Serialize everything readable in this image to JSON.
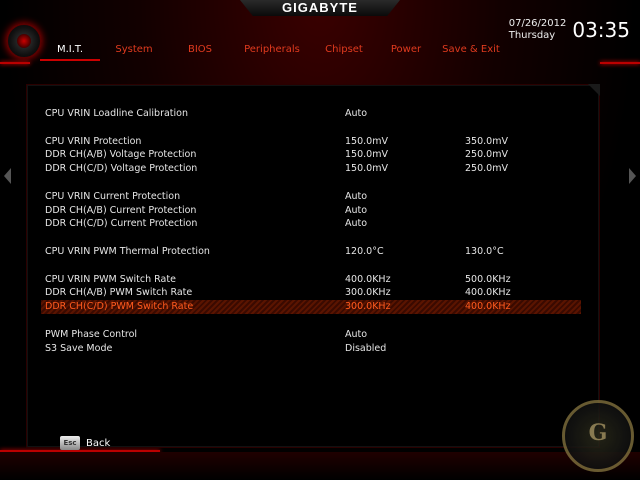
{
  "header": {
    "brand": "GIGABYTE",
    "date": "07/26/2012",
    "weekday": "Thursday",
    "time": "03:35"
  },
  "nav": {
    "tabs": [
      {
        "label": "M.I.T.",
        "active": true
      },
      {
        "label": "System",
        "active": false
      },
      {
        "label": "BIOS",
        "active": false
      },
      {
        "label": "Peripherals",
        "active": false
      },
      {
        "label": "Chipset",
        "active": false
      },
      {
        "label": "Power",
        "active": false
      },
      {
        "label": "Save & Exit",
        "active": false
      }
    ]
  },
  "settings": {
    "rows": [
      {
        "label": "CPU VRIN Loadline Calibration",
        "v1": "Auto",
        "v2": ""
      },
      {
        "gap": true
      },
      {
        "label": "CPU VRIN Protection",
        "v1": "150.0mV",
        "v2": "350.0mV"
      },
      {
        "label": "DDR CH(A/B) Voltage Protection",
        "v1": "150.0mV",
        "v2": "250.0mV"
      },
      {
        "label": "DDR CH(C/D) Voltage Protection",
        "v1": "150.0mV",
        "v2": "250.0mV"
      },
      {
        "gap": true
      },
      {
        "label": "CPU VRIN Current Protection",
        "v1": "Auto",
        "v2": ""
      },
      {
        "label": "DDR CH(A/B) Current Protection",
        "v1": "Auto",
        "v2": ""
      },
      {
        "label": "DDR CH(C/D) Current Protection",
        "v1": "Auto",
        "v2": ""
      },
      {
        "gap": true
      },
      {
        "label": "CPU VRIN PWM Thermal Protection",
        "v1": "120.0°C",
        "v2": "130.0°C"
      },
      {
        "gap": true
      },
      {
        "label": "CPU VRIN PWM Switch Rate",
        "v1": "400.0KHz",
        "v2": "500.0KHz"
      },
      {
        "label": "DDR CH(A/B) PWM Switch Rate",
        "v1": "300.0KHz",
        "v2": "400.0KHz"
      },
      {
        "label": "DDR CH(C/D) PWM Switch Rate",
        "v1": "300.0KHz",
        "v2": "400.0KHz",
        "selected": true
      },
      {
        "gap": true
      },
      {
        "label": "PWM Phase Control",
        "v1": "Auto",
        "v2": ""
      },
      {
        "label": "S3 Save Mode",
        "v1": "Disabled",
        "v2": ""
      }
    ]
  },
  "footer": {
    "esc_key": "Esc",
    "back_label": "Back"
  },
  "colors": {
    "accent": "#e03a1e",
    "selected_text": "#ff5a1e",
    "frame_red": "#b00000"
  }
}
